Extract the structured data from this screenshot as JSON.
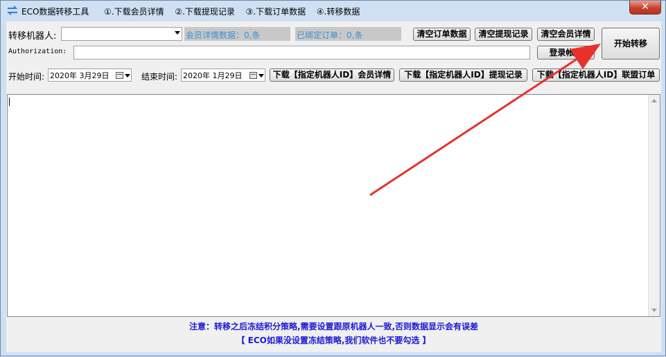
{
  "window": {
    "title": "ECO数据转移工具",
    "steps": [
      "①.下载会员详情",
      "②.下载提现记录",
      "③.下载订单数据",
      "④.转移数据"
    ],
    "close_label": "✕"
  },
  "robot": {
    "label": "转移机器人:",
    "selected": ""
  },
  "stats": {
    "member_detail": "会员详情数据：0,条",
    "bound_orders": "已绑定订单：0,条"
  },
  "buttons": {
    "clear_orders": "清空订单数据",
    "clear_withdraw": "清空提现记录",
    "clear_member": "清空会员详情",
    "start_transfer": "开始转移",
    "login": "登录帐号",
    "download_member": "下载【指定机器人ID】会员详情",
    "download_withdraw": "下载【指定机器人ID】提现记录",
    "download_orders": "下载【指定机器人ID】联盟订单"
  },
  "auth": {
    "label": "Authorization:",
    "value": ""
  },
  "dates": {
    "start_label": "开始时间:",
    "start_value": "2020年  3月29日",
    "end_label": "结束时间:",
    "end_value": "2020年  1月29日"
  },
  "log": {
    "content": ""
  },
  "notices": {
    "line1": "注意：转移之后冻结积分策略,需要设置跟原机器人一致,否则数据显示会有误差",
    "line2": "【 ECO如果没设置冻结策略,我们软件也不要勾选 】"
  },
  "colors": {
    "annotation_arrow": "#e8312b",
    "notice_text": "#1a1ad6",
    "stat_text": "#3c8fd0"
  }
}
